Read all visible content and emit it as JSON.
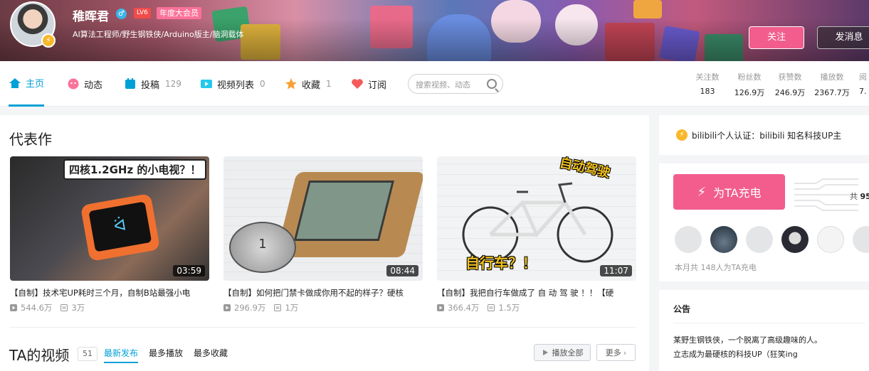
{
  "profile": {
    "name": "稚晖君",
    "level": "LV6",
    "vip_badge": "年度大会员",
    "sign": "AI算法工程师/野生钢铁侠/Arduino版主/脑洞载体",
    "follow_label": "关注",
    "message_label": "发消息"
  },
  "nav": {
    "items": [
      {
        "label": "主页",
        "count": "",
        "icon": "home-icon"
      },
      {
        "label": "动态",
        "count": "",
        "icon": "dynamic-icon"
      },
      {
        "label": "投稿",
        "count": "129",
        "icon": "upload-icon"
      },
      {
        "label": "视频列表",
        "count": "0",
        "icon": "playlist-icon"
      },
      {
        "label": "收藏",
        "count": "1",
        "icon": "star-icon"
      },
      {
        "label": "订阅",
        "count": "",
        "icon": "heart-icon"
      }
    ],
    "search_placeholder": "搜索视频、动态",
    "stats": [
      {
        "label": "关注数",
        "value": "183"
      },
      {
        "label": "粉丝数",
        "value": "126.9万"
      },
      {
        "label": "获赞数",
        "value": "246.9万"
      },
      {
        "label": "播放数",
        "value": "2367.7万"
      },
      {
        "label": "阅",
        "value": "7."
      }
    ]
  },
  "featured": {
    "title": "代表作",
    "videos": [
      {
        "title": "【自制】技术宅UP耗时三个月，自制B站最强小电",
        "duration": "03:59",
        "plays": "544.6万",
        "danmaku": "3万",
        "caption": "四核1.2GHz 的小电视？！"
      },
      {
        "title": "【自制】如何把门禁卡做成你用不起的样子？硬核",
        "duration": "08:44",
        "plays": "296.9万",
        "danmaku": "1万",
        "caption": ""
      },
      {
        "title": "【自制】我把自行车做成了 自 动 驾 驶 ！！【硬",
        "duration": "11:07",
        "plays": "366.4万",
        "danmaku": "1.5万",
        "caption": "自动驾驶",
        "caption2": "自行车？！"
      }
    ]
  },
  "videos_section": {
    "title": "TA的视频",
    "count": "51",
    "tabs": [
      "最新发布",
      "最多播放",
      "最多收藏"
    ],
    "play_all": "播放全部",
    "more": "更多"
  },
  "sidebar": {
    "cert": "bilibili个人认证：bilibili 知名科技UP主",
    "charge_label": "为TA充电",
    "total_prefix": "共",
    "total_value": "95",
    "charge_note": "本月共 148人为TA充电",
    "notice_title": "公告",
    "notice_lines": [
      "某野生钢铁侠，一个脱离了高级趣味的人。",
      "立志成为最硬核的科技UP（狂笑ing"
    ]
  }
}
